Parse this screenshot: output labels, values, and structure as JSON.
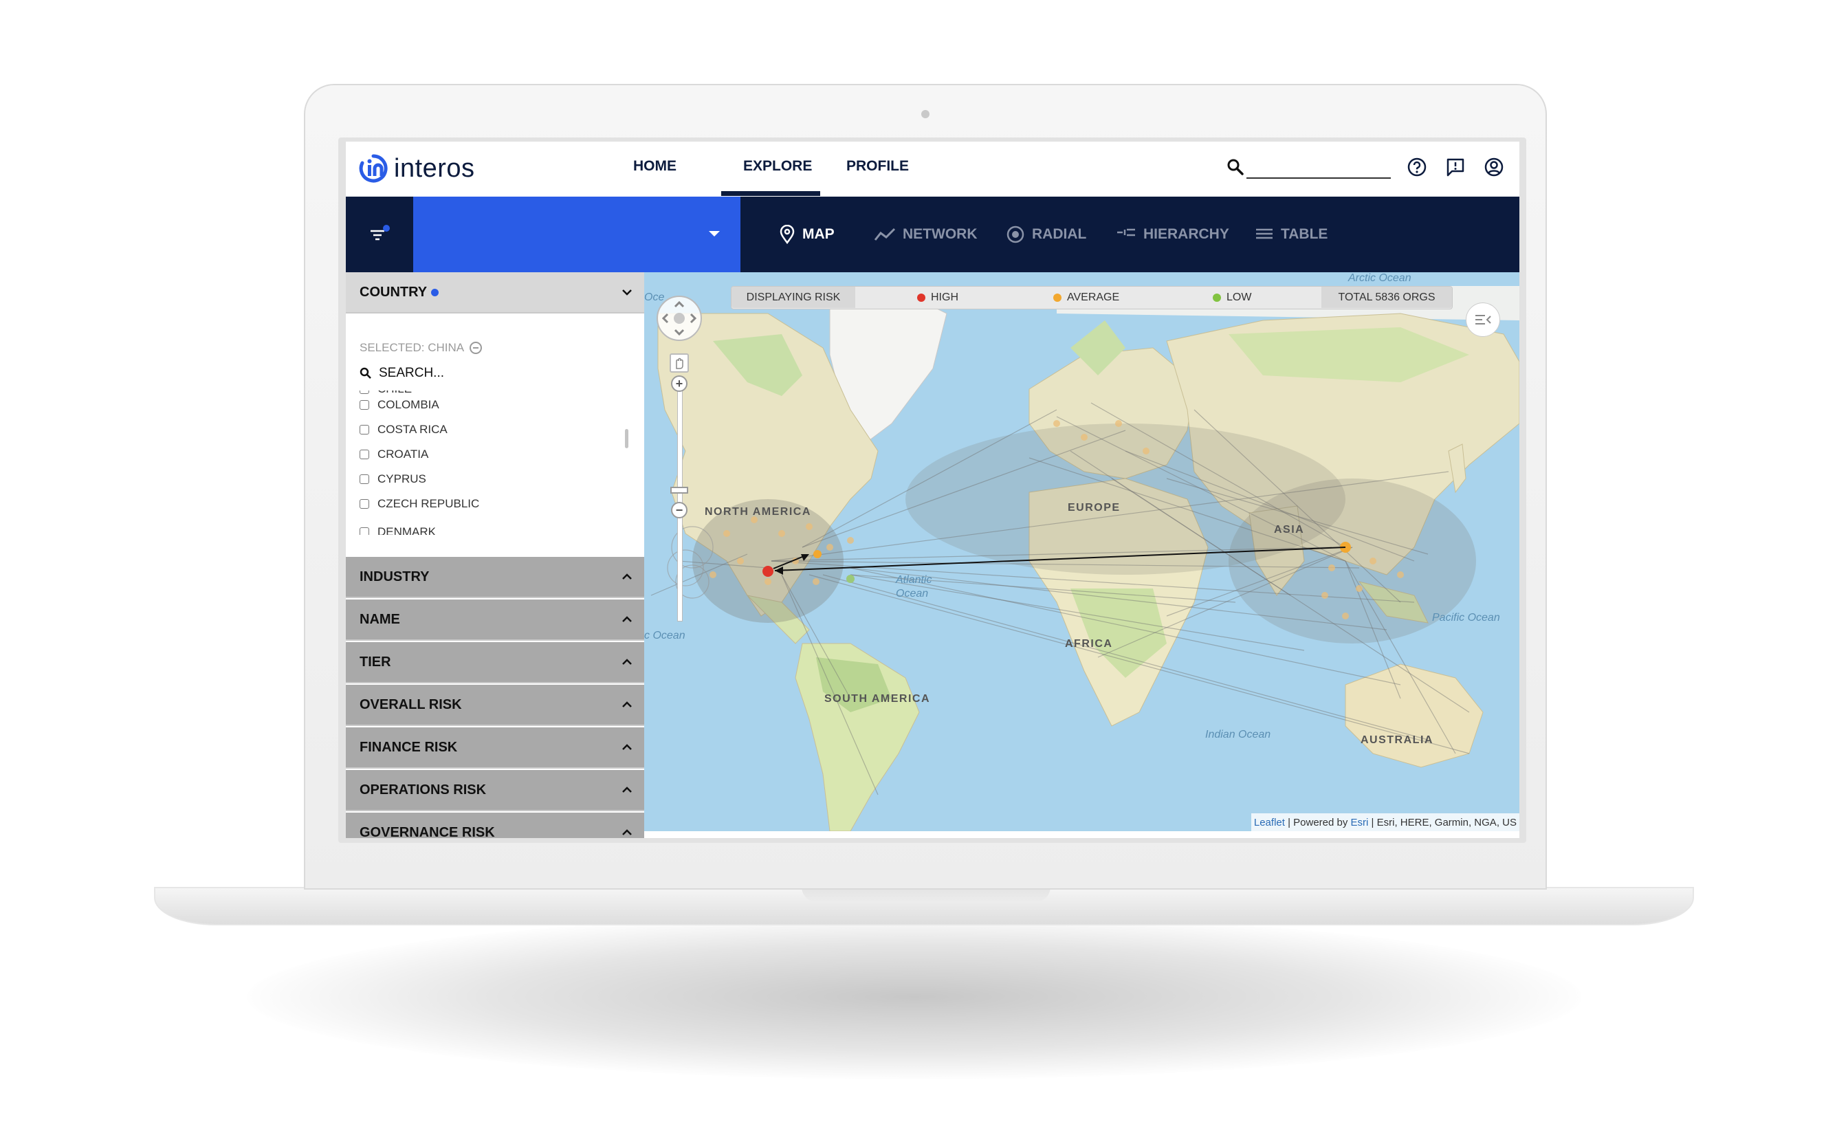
{
  "colors": {
    "navy": "#0b1a3d",
    "accent": "#2a5ce6",
    "high": "#e0362b",
    "average": "#f2a830",
    "low": "#82c341"
  },
  "header": {
    "logo": "interos",
    "nav": [
      {
        "label": "HOME"
      },
      {
        "label": "EXPLORE",
        "active": true
      },
      {
        "label": "PROFILE"
      }
    ],
    "icons": [
      "search-icon",
      "help-icon",
      "feedback-icon",
      "account-icon"
    ]
  },
  "toolbar": {
    "dropdown_value": "",
    "views": [
      {
        "label": "MAP",
        "icon": "map-pin-icon",
        "active": true
      },
      {
        "label": "NETWORK",
        "icon": "network-icon"
      },
      {
        "label": "RADIAL",
        "icon": "radial-icon"
      },
      {
        "label": "HIERARCHY",
        "icon": "hierarchy-icon"
      },
      {
        "label": "TABLE",
        "icon": "table-icon"
      }
    ]
  },
  "sidebar": {
    "country": {
      "title": "COUNTRY",
      "selected": "SELECTED: CHINA",
      "search_placeholder": "SEARCH...",
      "items": [
        "CHILE",
        "COLOMBIA",
        "COSTA RICA",
        "CROATIA",
        "CYPRUS",
        "CZECH REPUBLIC",
        "DENMARK"
      ]
    },
    "sections": [
      "INDUSTRY",
      "NAME",
      "TIER",
      "OVERALL RISK",
      "FINANCE RISK",
      "OPERATIONS RISK",
      "GOVERNANCE RISK"
    ]
  },
  "map": {
    "legend": {
      "displaying": "DISPLAYING RISK",
      "high": "HIGH",
      "average": "AVERAGE",
      "low": "LOW",
      "total": "TOTAL 5836 ORGS"
    },
    "regions": [
      "NORTH AMERICA",
      "EUROPE",
      "ASIA",
      "AFRICA",
      "SOUTH AMERICA",
      "AUSTRALIA"
    ],
    "oceans": [
      "Arctic Ocean",
      "Atlantic Ocean",
      "Pacific Ocean",
      "Indian Ocean",
      "c Ocean",
      "Oce"
    ],
    "attribution": {
      "leaflet": "Leaflet",
      "powered": " | Powered by ",
      "esri": "Esri",
      "rest": " | Esri, HERE, Garmin, NGA, US"
    }
  }
}
